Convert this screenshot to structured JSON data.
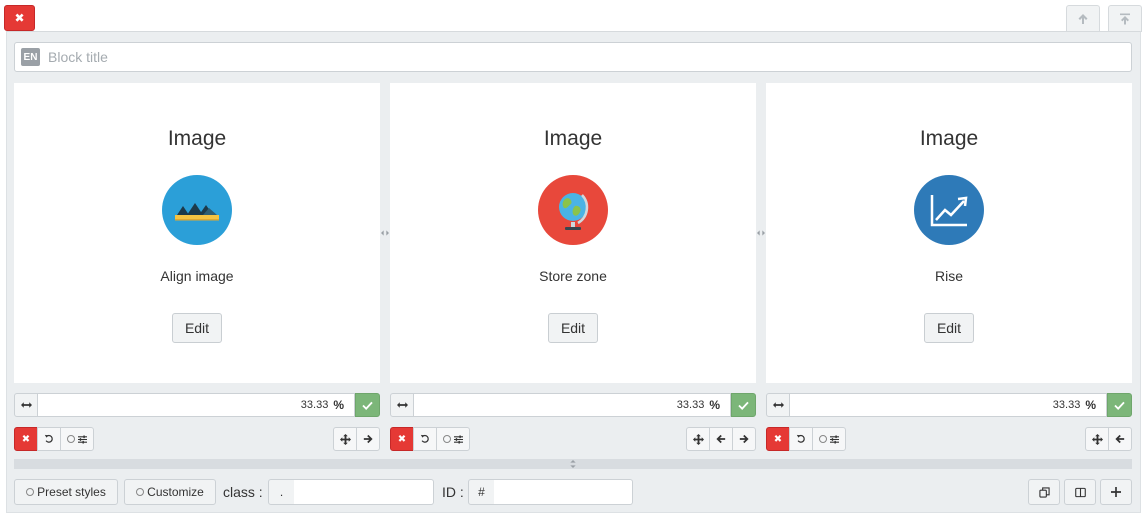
{
  "header": {
    "close_label": "✖",
    "icons": [
      "close-icon",
      "arrow-up-icon",
      "arrow-to-top-icon"
    ]
  },
  "title_field": {
    "lang_badge": "EN",
    "placeholder": "Block title",
    "value": ""
  },
  "columns": [
    {
      "title": "Image",
      "label": "Align image",
      "edit_label": "Edit",
      "width_value": "33.33",
      "unit": "%",
      "icon": "landscape-icon",
      "icon_color": "#2b9fd8"
    },
    {
      "title": "Image",
      "label": "Store zone",
      "edit_label": "Edit",
      "width_value": "33.33",
      "unit": "%",
      "icon": "globe-icon",
      "icon_color": "#e8483b"
    },
    {
      "title": "Image",
      "label": "Rise",
      "edit_label": "Edit",
      "width_value": "33.33",
      "unit": "%",
      "icon": "line-chart-rise-icon",
      "icon_color": "#2e7ab8"
    }
  ],
  "bottom": {
    "preset_label": "Preset styles",
    "customize_label": "Customize",
    "class_label": "class :",
    "class_prefix": ".",
    "class_value": "",
    "id_label": "ID :",
    "id_prefix": "#",
    "id_value": ""
  },
  "colors": {
    "danger": "#e53935",
    "success": "#7cb679",
    "panel_bg": "#ebeef0"
  }
}
